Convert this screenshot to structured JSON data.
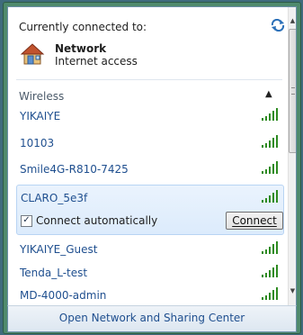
{
  "current": {
    "title": "Currently connected to:",
    "network_name": "Network",
    "network_status": "Internet access"
  },
  "section": {
    "label": "Wireless"
  },
  "networks": [
    {
      "name": "YIKAIYE",
      "signal": 5
    },
    {
      "name": "10103",
      "signal": 5
    },
    {
      "name": "Smile4G-R810-7425",
      "signal": 5
    },
    {
      "name": "CLARO_5e3f",
      "signal": 5
    },
    {
      "name": "YIKAIYE_Guest",
      "signal": 5
    },
    {
      "name": "Tenda_L-test",
      "signal": 5
    },
    {
      "name": "MD-4000-admin",
      "signal": 5
    }
  ],
  "selected": {
    "name": "CLARO_5e3f",
    "checkbox_label": "Connect automatically",
    "checked": true,
    "connect_label": "Connect"
  },
  "footer": {
    "link": "Open Network and Sharing Center"
  },
  "colors": {
    "link": "#1f4f8f",
    "signal": "#2e8b22",
    "selection_bg": "#dcebfc"
  }
}
